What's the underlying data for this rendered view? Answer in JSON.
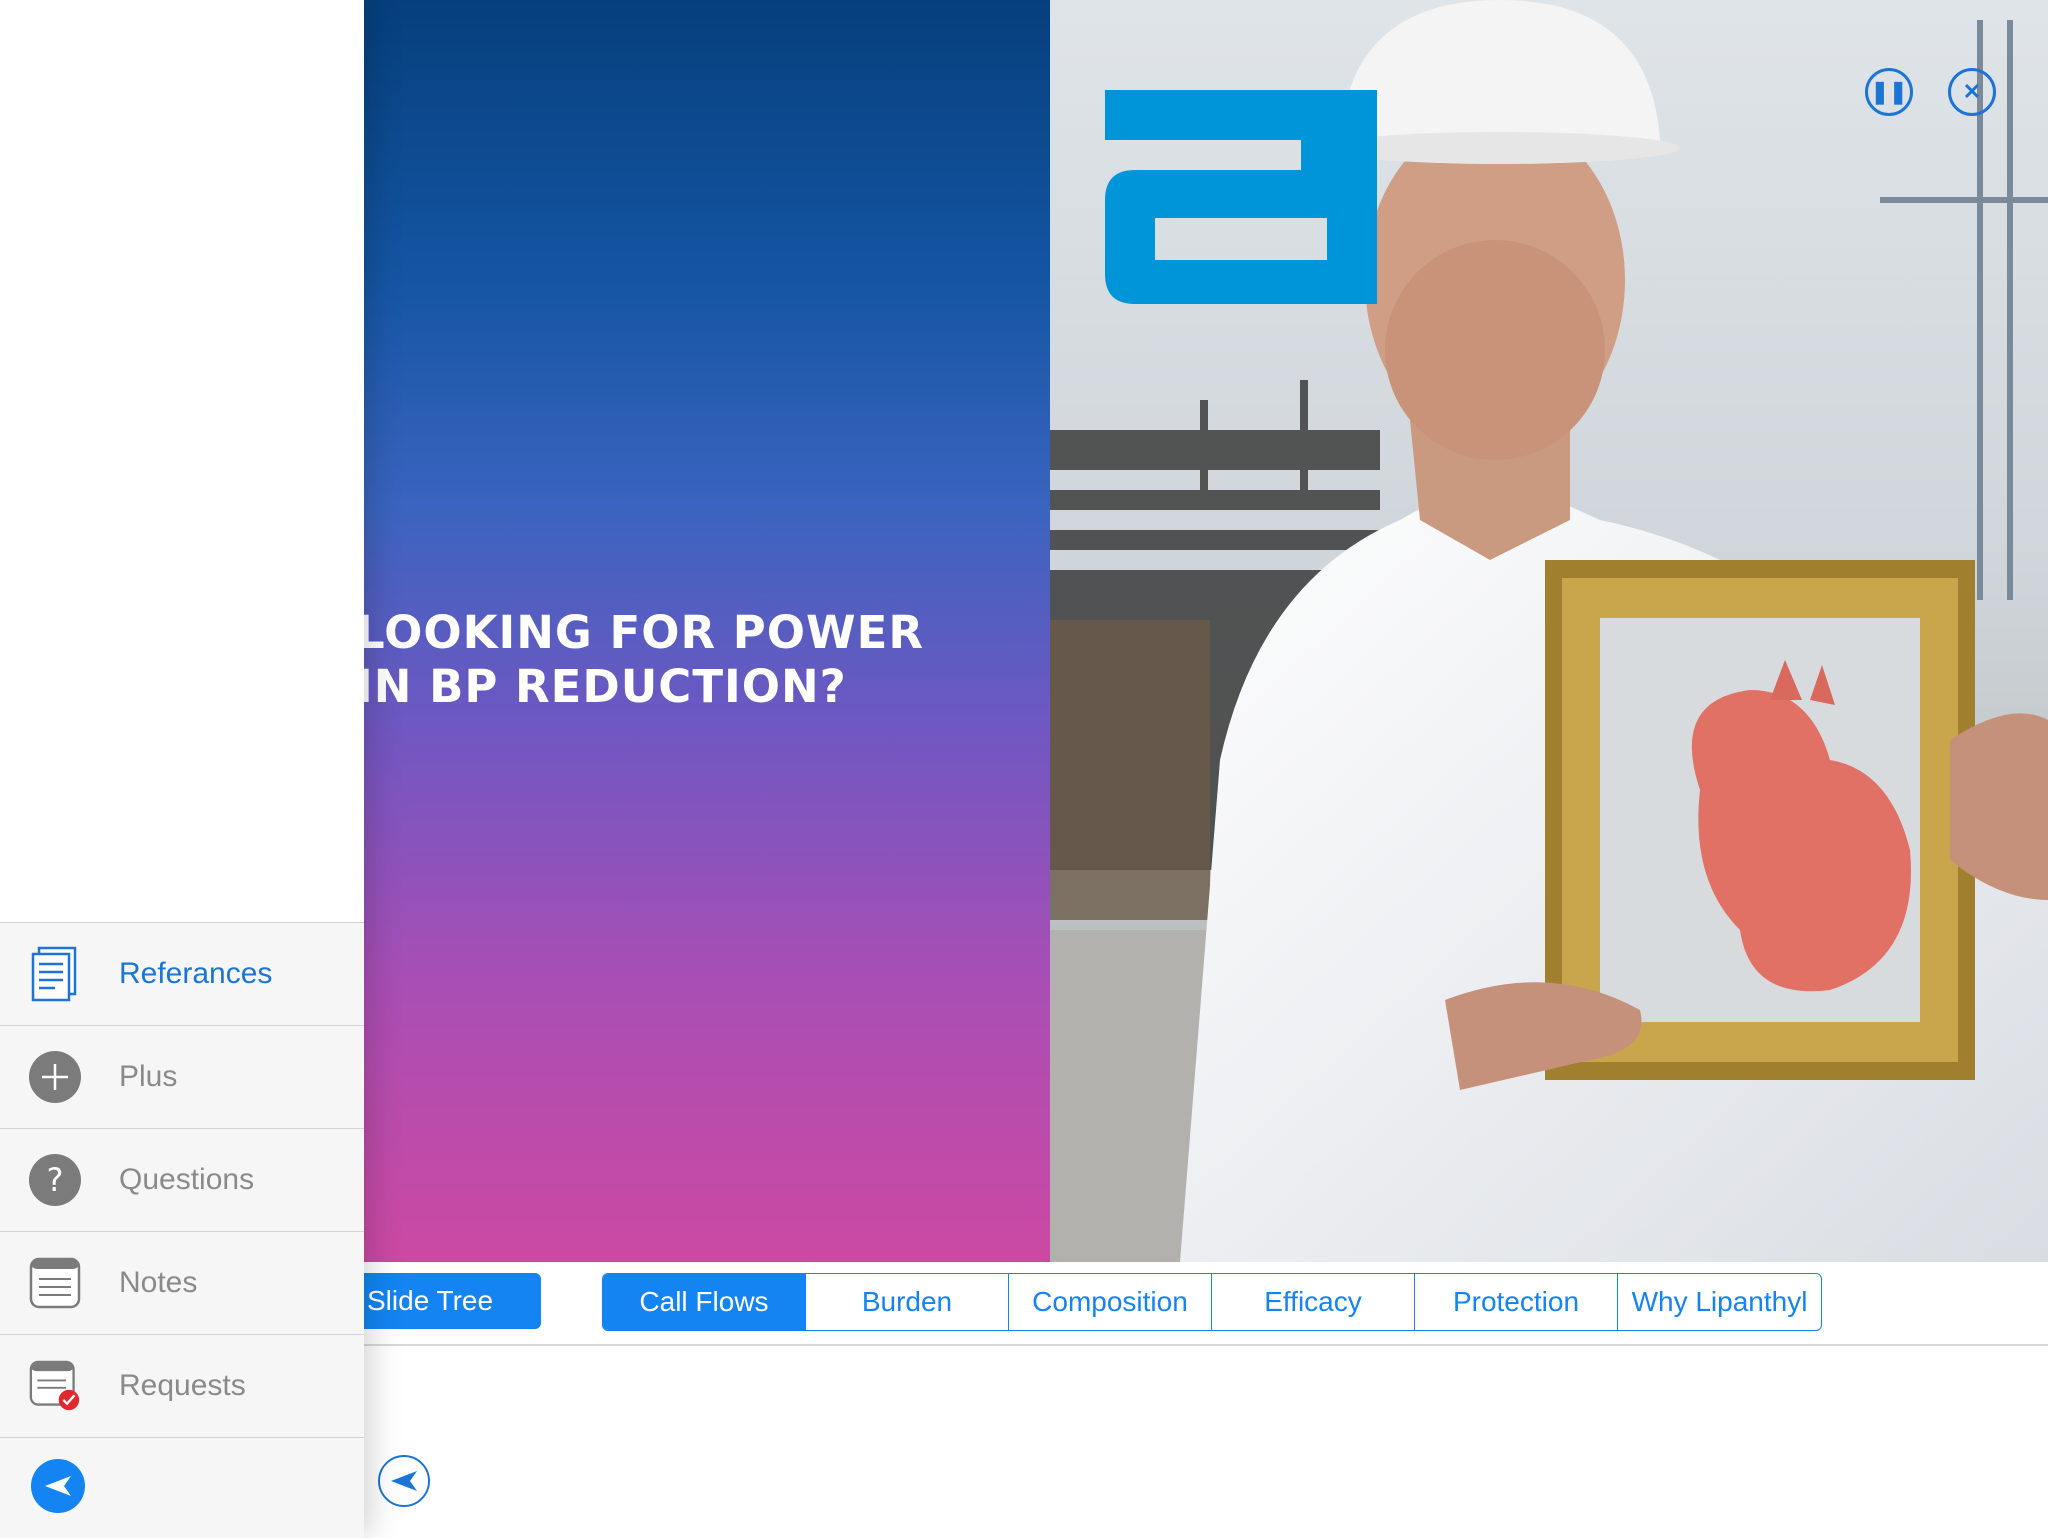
{
  "slide": {
    "headline_lines": [
      "LOOKING FOR POWER",
      "IN BP REDUCTION?"
    ]
  },
  "controls": {
    "pause_icon": "pause-icon",
    "close_icon": "close-icon"
  },
  "menu": {
    "items": [
      {
        "label": "Referances",
        "icon": "document-icon",
        "active": true
      },
      {
        "label": "Plus",
        "icon": "plus-icon",
        "active": false
      },
      {
        "label": "Questions",
        "icon": "question-icon",
        "active": false
      },
      {
        "label": "Notes",
        "icon": "notes-icon",
        "active": false
      },
      {
        "label": "Requests",
        "icon": "requests-icon",
        "active": false
      }
    ],
    "back_icon": "back-arrow-icon"
  },
  "toolbar": {
    "slide_tree_label": "Slide Tree",
    "tabs": [
      {
        "label": "Call Flows",
        "active": true
      },
      {
        "label": "Burden",
        "active": false
      },
      {
        "label": "Composition",
        "active": false
      },
      {
        "label": "Efficacy",
        "active": false
      },
      {
        "label": "Protection",
        "active": false
      },
      {
        "label": "Why Lipanthyl",
        "active": false
      }
    ]
  },
  "colors": {
    "accent": "#1384f2",
    "logo_blue": "#0095d9"
  }
}
